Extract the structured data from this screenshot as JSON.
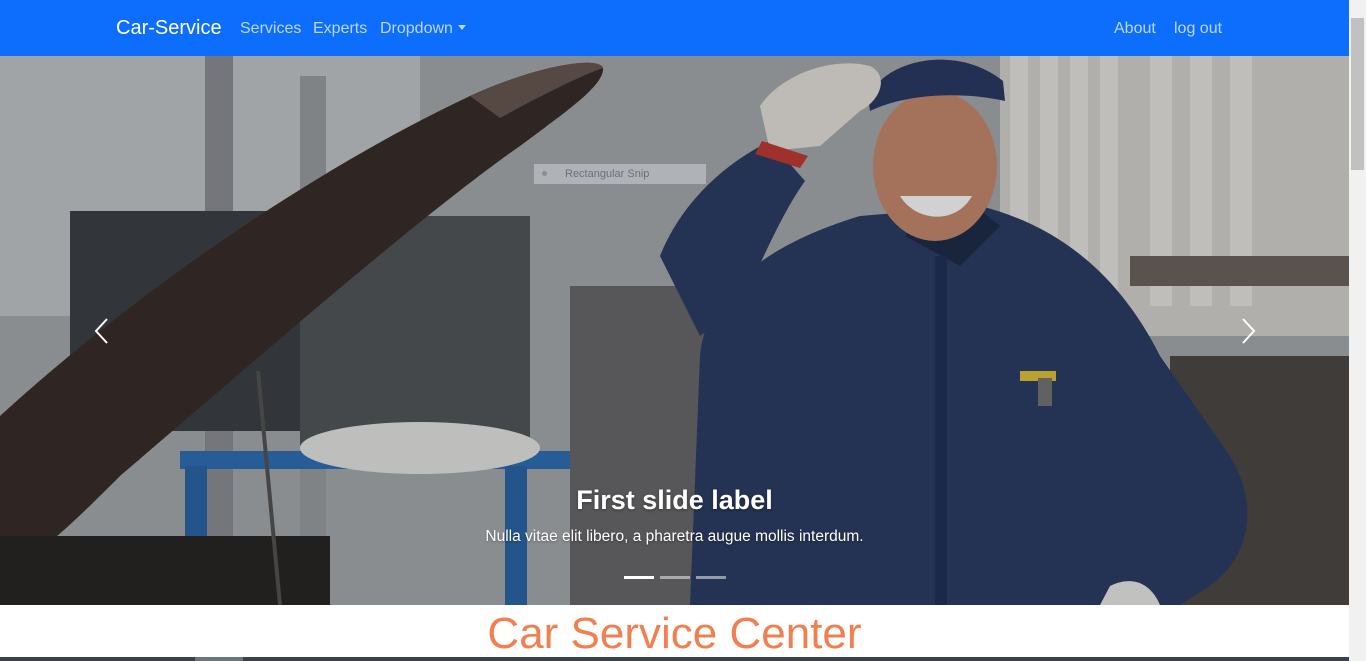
{
  "navbar": {
    "brand": "Car-Service",
    "links": {
      "services": "Services",
      "experts": "Experts",
      "dropdown": "Dropdown",
      "about": "About",
      "logout": "log out"
    },
    "background_color": "#0d6efd"
  },
  "carousel": {
    "overlay_tag": "Rectangular Snip",
    "caption_title": "First slide label",
    "caption_text": "Nulla vitae elit libero, a pharetra augue mollis interdum.",
    "indicators_count": 3,
    "active_indicator": 1,
    "prev_icon": "chevron-left-icon",
    "next_icon": "chevron-right-icon"
  },
  "main": {
    "heading": "Car Service Center",
    "heading_color": "#f27f50"
  }
}
